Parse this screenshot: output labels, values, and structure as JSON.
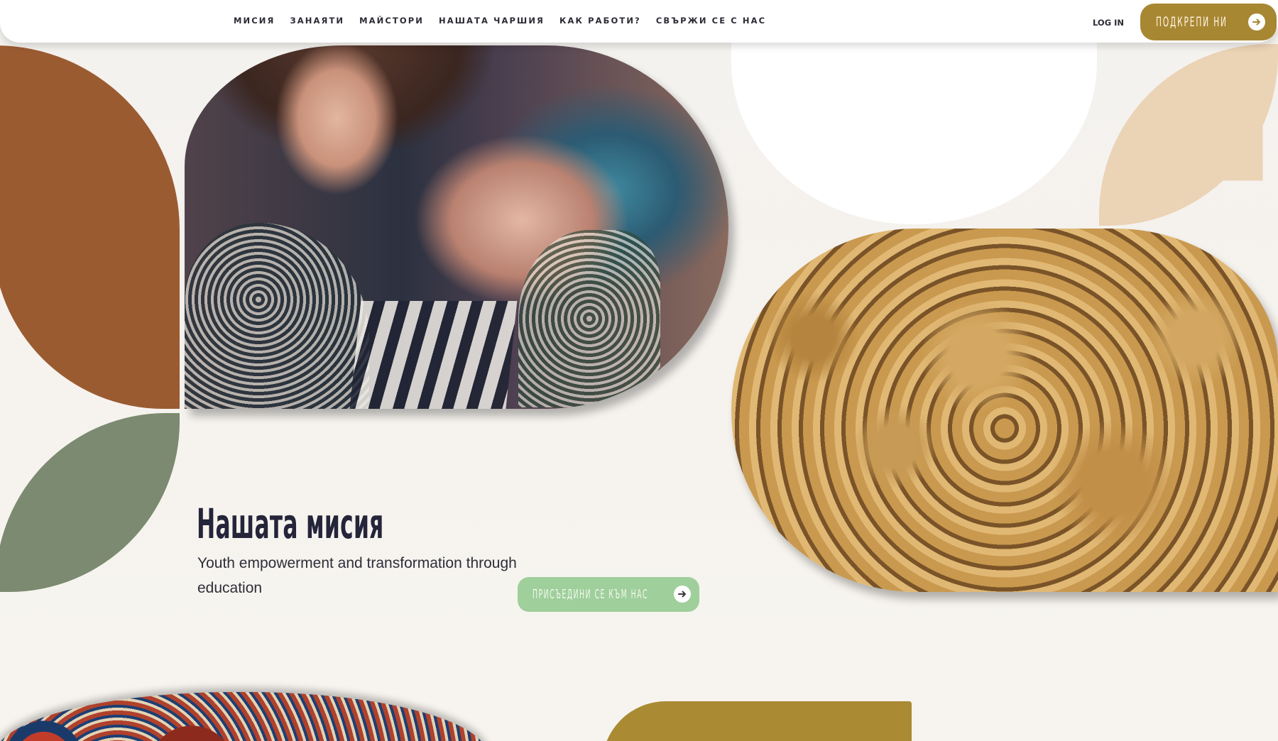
{
  "nav": {
    "items": [
      {
        "label": "МИСИЯ"
      },
      {
        "label": "ЗАНАЯТИ"
      },
      {
        "label": "МАЙСТОРИ"
      },
      {
        "label": "НАШАТА ЧАРШИЯ"
      },
      {
        "label": "КАК РАБОТИ?"
      },
      {
        "label": "СВЪРЖИ СЕ С НАС"
      }
    ],
    "login": "LOG IN",
    "support": "ПОДКРЕПИ НИ"
  },
  "hero": {
    "title": "Нашата мисия",
    "subtitle": "Youth empowerment and transformation through education",
    "join": "ПРИСЪЕДИНИ СЕ КЪМ НАС"
  },
  "colors": {
    "brown": "#9b5b31",
    "sage": "#7b8a70",
    "beige": "#ebd3b5",
    "gold": "#a88733",
    "mint": "#9fcf9b",
    "text": "#24243a"
  },
  "icons": [
    "arrow-right-icon"
  ]
}
